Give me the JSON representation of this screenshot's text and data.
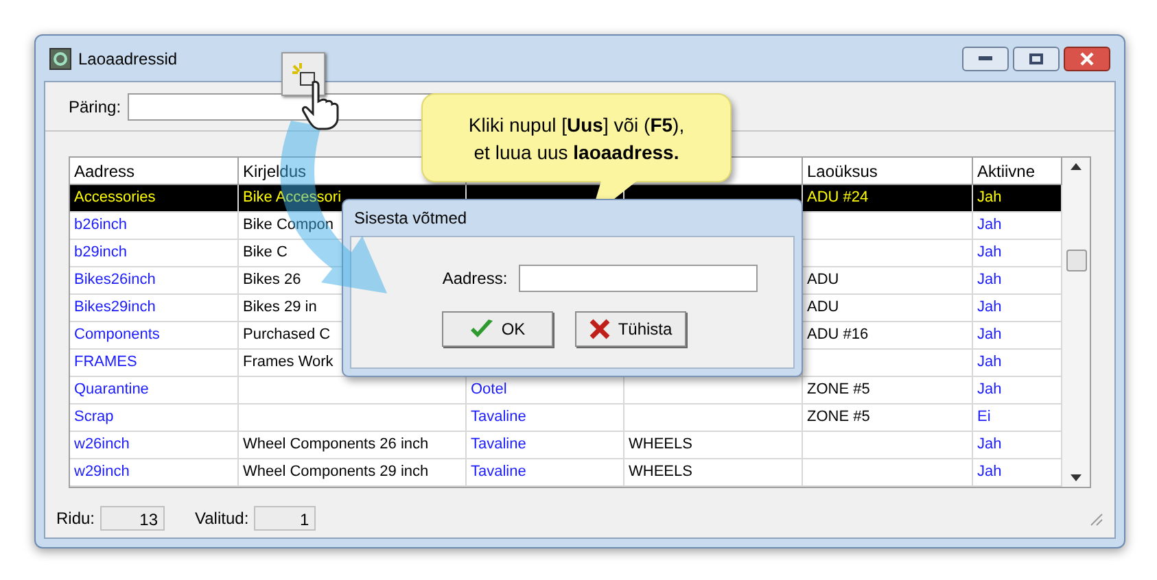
{
  "window": {
    "title": "Laoaadressid"
  },
  "query": {
    "label": "Päring:"
  },
  "table": {
    "columns": [
      "Aadress",
      "Kirjeldus",
      null,
      null,
      "Laoüksus",
      "Aktiivne"
    ],
    "rows": [
      {
        "selected": true,
        "cells": [
          "Accessories",
          "Bike Accessori",
          null,
          null,
          "ADU #24",
          "Jah"
        ]
      },
      {
        "selected": false,
        "cells": [
          "b26inch",
          "Bike Compon",
          null,
          null,
          null,
          "Jah"
        ]
      },
      {
        "selected": false,
        "cells": [
          "b29inch",
          "Bike C",
          null,
          null,
          null,
          "Jah"
        ]
      },
      {
        "selected": false,
        "cells": [
          "Bikes26inch",
          "Bikes 26",
          null,
          null,
          "ADU",
          "Jah"
        ]
      },
      {
        "selected": false,
        "cells": [
          "Bikes29inch",
          "Bikes 29 in",
          null,
          null,
          "ADU",
          "Jah"
        ]
      },
      {
        "selected": false,
        "cells": [
          "Components",
          "Purchased C",
          null,
          null,
          "ADU #16",
          "Jah"
        ]
      },
      {
        "selected": false,
        "cells": [
          "FRAMES",
          "Frames Work",
          null,
          null,
          null,
          "Jah"
        ]
      },
      {
        "selected": false,
        "cells": [
          "Quarantine",
          null,
          "Ootel",
          null,
          "ZONE #5",
          "Jah"
        ]
      },
      {
        "selected": false,
        "cells": [
          "Scrap",
          null,
          "Tavaline",
          null,
          "ZONE #5",
          "Ei"
        ]
      },
      {
        "selected": false,
        "cells": [
          "w26inch",
          "Wheel Components 26 inch",
          "Tavaline",
          "WHEELS",
          null,
          "Jah"
        ]
      },
      {
        "selected": false,
        "cells": [
          "w29inch",
          "Wheel Components 29 inch",
          "Tavaline",
          "WHEELS",
          null,
          "Jah"
        ]
      }
    ]
  },
  "status_bar": {
    "rows_label": "Ridu:",
    "rows_value": "13",
    "selected_label": "Valitud:",
    "selected_value": "1"
  },
  "callout": {
    "lines": [
      "Kliki nupul [**Uus**] või (**F5**),",
      "et luua uus **laoaadress.**"
    ]
  },
  "dialog": {
    "title": "Sisesta võtmed",
    "field_label": "Aadress:",
    "buttons": [
      {
        "kind": "ok",
        "label": "OK"
      },
      {
        "kind": "cancel",
        "label": "Tühista"
      }
    ]
  }
}
